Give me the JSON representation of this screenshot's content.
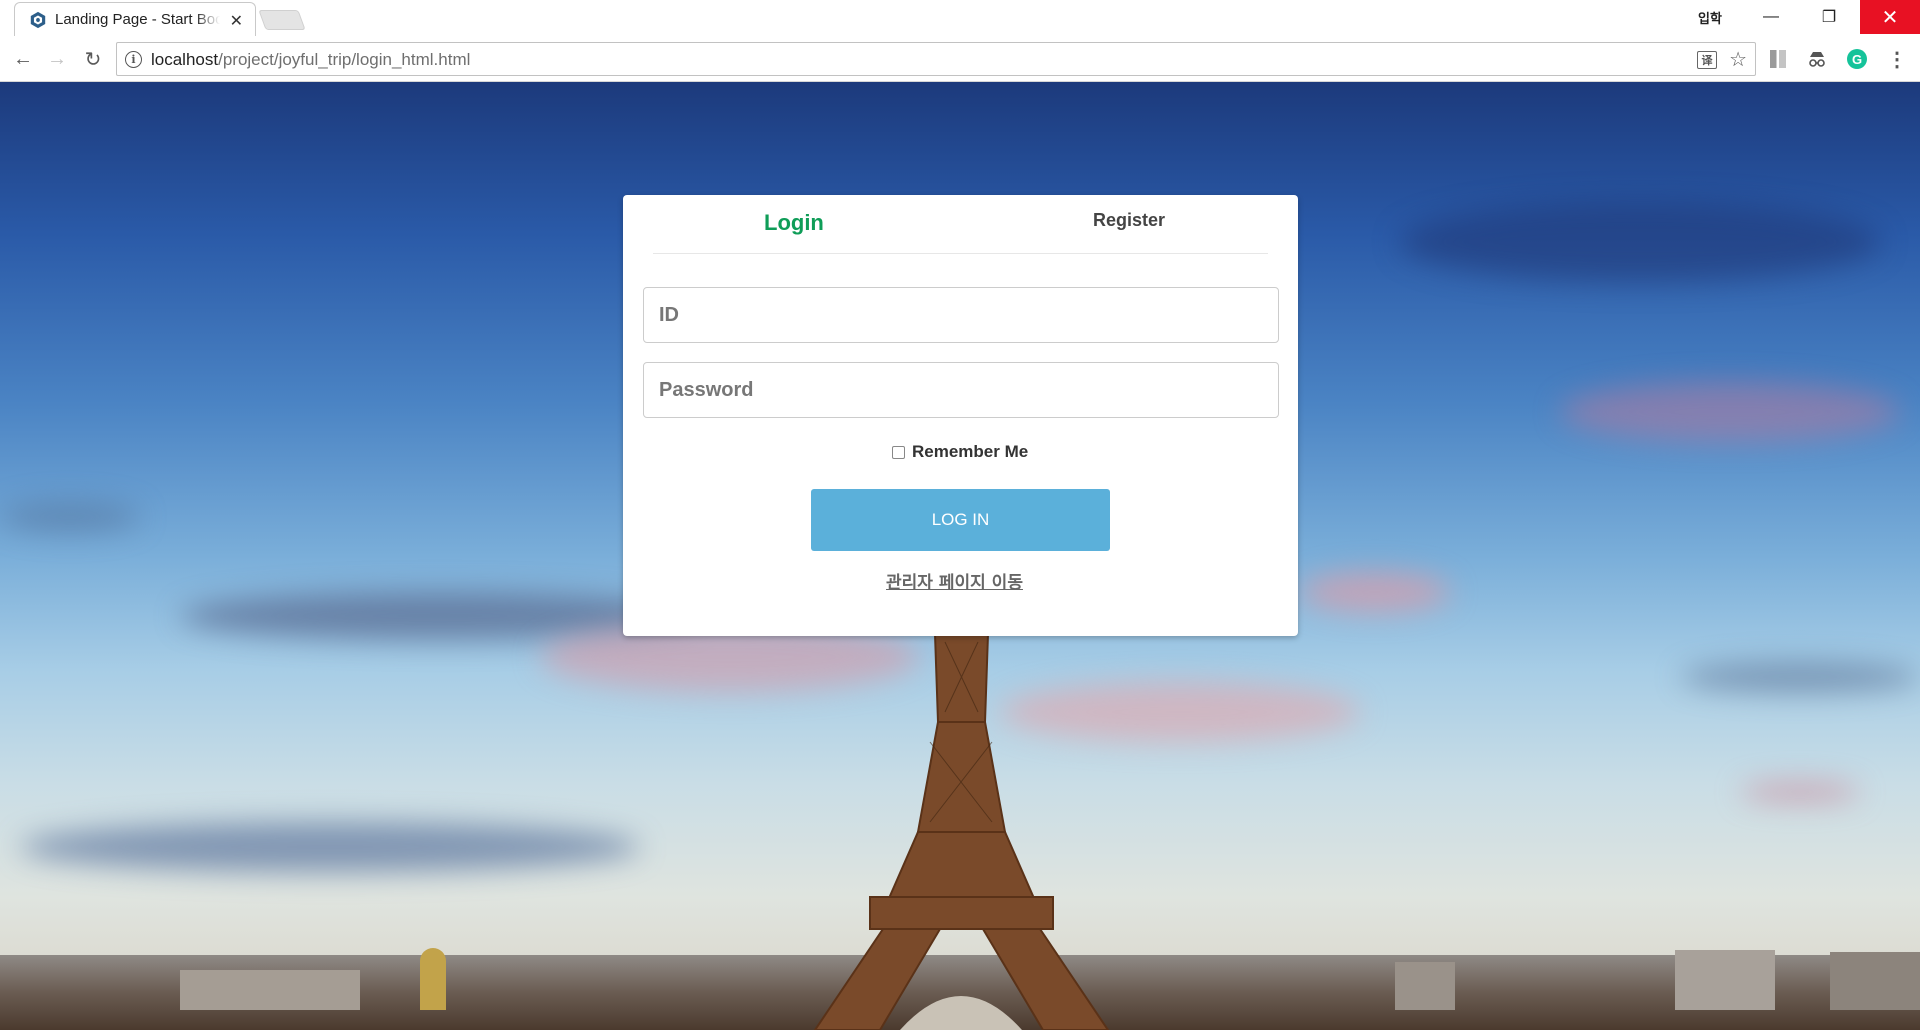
{
  "browser": {
    "tab_title": "Landing Page - Start Bootstrap",
    "tab_close": "✕",
    "url_host": "localhost",
    "url_path": "/project/joyful_trip/login_html.html",
    "user_badge": "입학",
    "window_controls": {
      "minimize": "—",
      "maximize": "❐",
      "close": "✕"
    },
    "nav": {
      "back": "←",
      "forward": "→",
      "reload": "↻"
    },
    "omnibox_icons": {
      "info": "i",
      "translate": "译",
      "star": "☆"
    },
    "extensions": {
      "grammarly": "G",
      "menu": "⋮",
      "incognito": "👓"
    },
    "colors": {
      "close_button": "#e81123",
      "grammarly": "#15c39a"
    }
  },
  "login_card": {
    "tab_login": "Login",
    "tab_register": "Register",
    "id_placeholder": "ID",
    "password_placeholder": "Password",
    "remember_label": "Remember Me",
    "remember_checked": false,
    "login_button": "LOG IN",
    "admin_link": "관리자 페이지 이동",
    "colors": {
      "active_tab": "#0f9d58",
      "login_button": "#5bb0da"
    }
  }
}
